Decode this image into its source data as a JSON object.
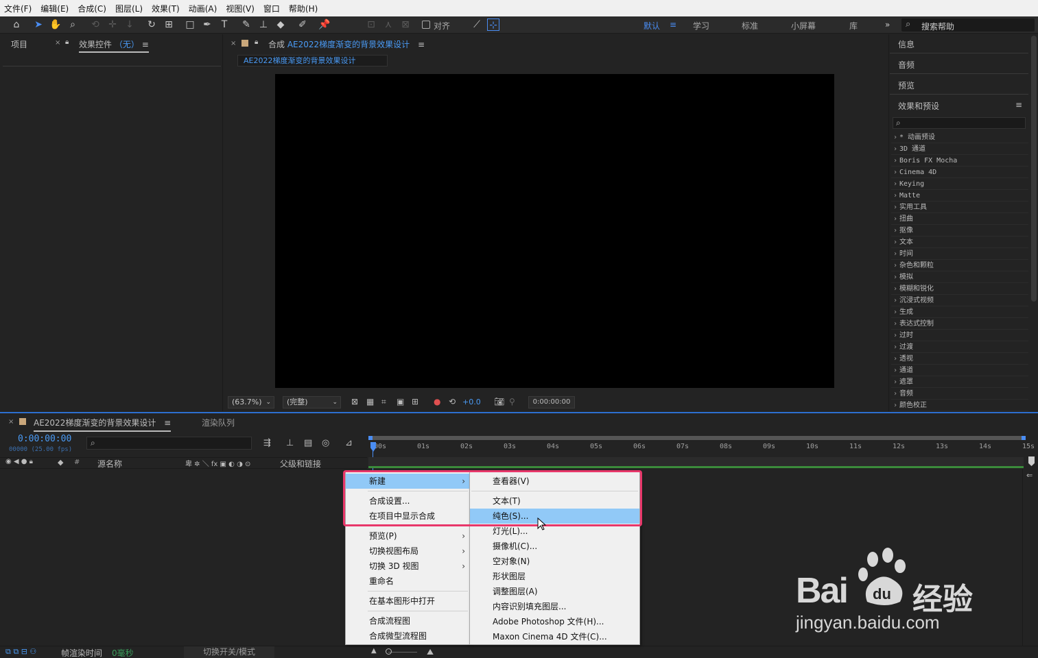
{
  "menubar": [
    "文件(F)",
    "编辑(E)",
    "合成(C)",
    "图层(L)",
    "效果(T)",
    "动画(A)",
    "视图(V)",
    "窗口",
    "帮助(H)"
  ],
  "toolbar": {
    "align_label": "对齐",
    "workspaces": [
      "默认",
      "学习",
      "标准",
      "小屏幕",
      "库"
    ],
    "overflow": "»",
    "help_placeholder": "搜索帮助"
  },
  "project_panel": {
    "tab_project": "项目",
    "tab_effects_prefix": "效果控件",
    "tab_effects_none": "（无）"
  },
  "comp_panel": {
    "title_prefix": "合成",
    "comp_name": "AE2022梯度渐变的背景效果设计",
    "subtab": "AE2022梯度渐变的背景效果设计",
    "zoom": "(63.7%)",
    "resolution": "(完整)",
    "exposure": "+0.0",
    "timecode": "0:00:00:00"
  },
  "right_panel": {
    "info": "信息",
    "audio": "音频",
    "preview": "预览",
    "effects_title": "效果和预设",
    "effects": [
      "* 动画预设",
      "3D 通道",
      "Boris FX Mocha",
      "Cinema 4D",
      "Keying",
      "Matte",
      "实用工具",
      "扭曲",
      "抠像",
      "文本",
      "时间",
      "杂色和颗粒",
      "模拟",
      "模糊和锐化",
      "沉浸式视频",
      "生成",
      "表达式控制",
      "过时",
      "过渡",
      "透视",
      "通道",
      "遮罩",
      "音频",
      "颜色校正"
    ]
  },
  "timeline": {
    "tab_comp": "AE2022梯度渐变的背景效果设计",
    "tab_render": "渲染队列",
    "timecode": "0:00:00:00",
    "frames": "00000 (25.00 fps)",
    "col_hash": "#",
    "col_source": "源名称",
    "col_parent": "父级和链接",
    "ruler": [
      "00s",
      "01s",
      "02s",
      "03s",
      "04s",
      "05s",
      "06s",
      "07s",
      "08s",
      "09s",
      "10s",
      "11s",
      "12s",
      "13s",
      "14s",
      "15s"
    ],
    "footer_render_label": "帧渲染时间",
    "footer_render_value": "0毫秒",
    "footer_toggle": "切换开关/模式"
  },
  "context_menu": {
    "items": [
      {
        "label": "新建",
        "submenu": true
      },
      {
        "label": "合成设置..."
      },
      {
        "label": "在项目中显示合成"
      },
      {
        "label": "预览(P)",
        "submenu": true
      },
      {
        "label": "切换视图布局",
        "submenu": true
      },
      {
        "label": "切换 3D 视图",
        "submenu": true
      },
      {
        "label": "重命名"
      },
      {
        "label": "在基本图形中打开"
      },
      {
        "label": "合成流程图"
      },
      {
        "label": "合成微型流程图"
      }
    ],
    "submenu": [
      {
        "label": "查看器(V)"
      },
      {
        "label": "文本(T)"
      },
      {
        "label": "纯色(S)..."
      },
      {
        "label": "灯光(L)..."
      },
      {
        "label": "摄像机(C)..."
      },
      {
        "label": "空对象(N)"
      },
      {
        "label": "形状图层"
      },
      {
        "label": "调整图层(A)"
      },
      {
        "label": "内容识别填充图层..."
      },
      {
        "label": "Adobe Photoshop 文件(H)..."
      },
      {
        "label": "Maxon Cinema 4D 文件(C)..."
      }
    ]
  },
  "watermark": {
    "brand": "Bai",
    "brand2": "经验",
    "url": "jingyan.baidu.com"
  },
  "colors": {
    "accent": "#4a9bf6",
    "highlight": "#e8376a",
    "menu_selected": "#91c9f7"
  }
}
